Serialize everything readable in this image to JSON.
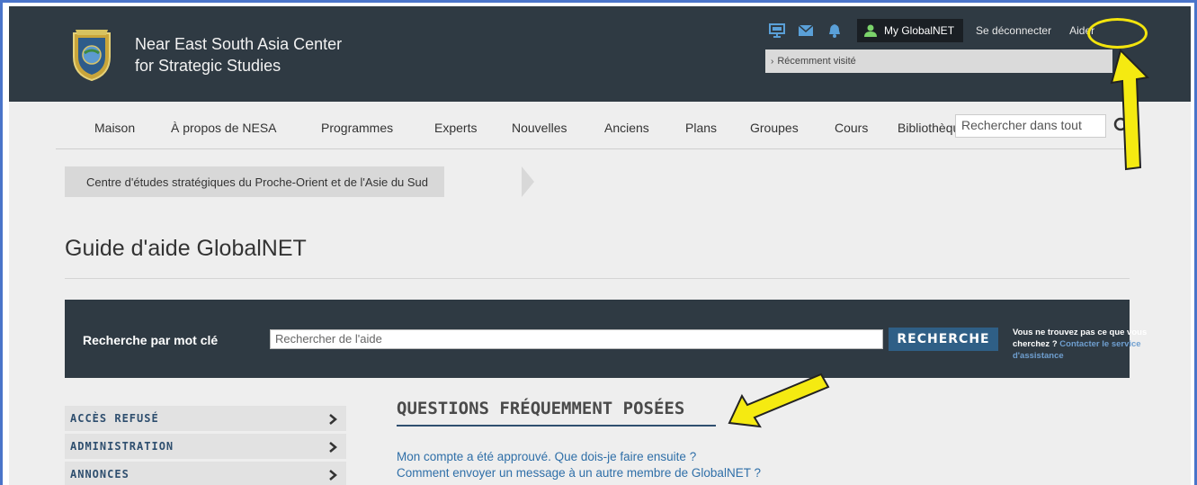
{
  "header": {
    "org_line1": "Near East South Asia Center",
    "org_line2": "for Strategic Studies",
    "my_globalnet": "My GlobalNET",
    "logout": "Se déconnecter",
    "help": "Aider",
    "recent": "Récemment visité"
  },
  "nav": {
    "items": [
      "Maison",
      "À propos de NESA",
      "Programmes",
      "Experts",
      "Nouvelles",
      "Anciens",
      "Plans",
      "Groupes",
      "Cours",
      "Bibliothèque"
    ],
    "search_placeholder": "Rechercher dans tout"
  },
  "breadcrumb": "Centre d'études stratégiques du Proche-Orient et de l'Asie du Sud",
  "page_title": "Guide d'aide GlobalNET",
  "search_band": {
    "label": "Recherche par mot clé",
    "placeholder": "Rechercher de l'aide",
    "button": "RECHERCHE",
    "help_text": "Vous ne trouvez pas ce que vous cherchez ?",
    "help_link": "Contacter le service d'assistance"
  },
  "sidebar": {
    "items": [
      "ACCÈS REFUSÉ",
      "ADMINISTRATION",
      "ANNONCES"
    ]
  },
  "faq": {
    "title": "QUESTIONS FRÉQUEMMENT POSÉES",
    "links": [
      "Mon compte a été approuvé. Que dois-je faire ensuite ?",
      "Comment envoyer un message à un autre membre de GlobalNET ?"
    ]
  },
  "colors": {
    "header_bg": "#2f3a43",
    "accent_blue": "#2f5f86",
    "annotation_yellow": "#f3e40d",
    "frame_blue": "#4a74c9"
  }
}
